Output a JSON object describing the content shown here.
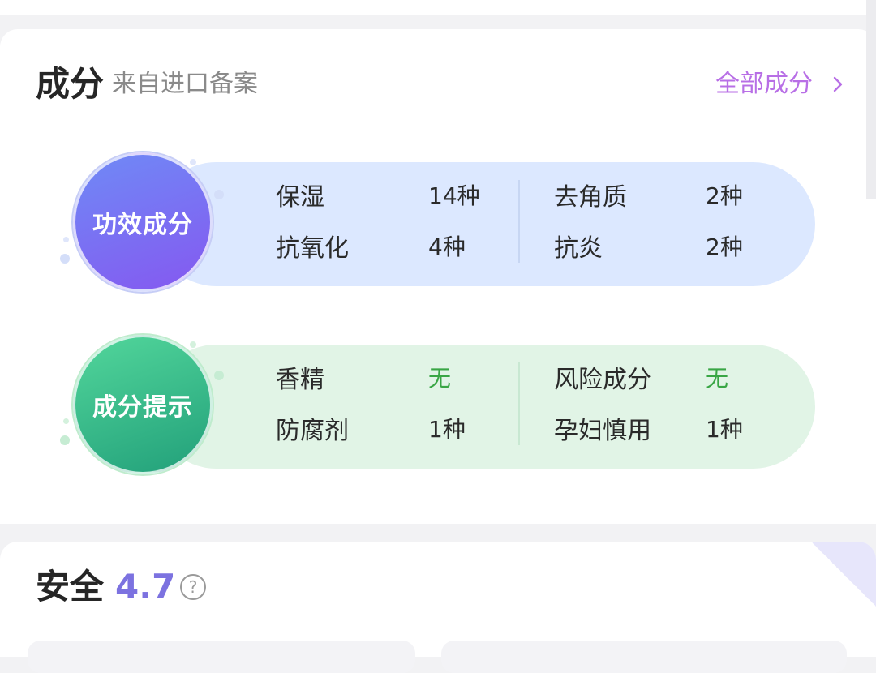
{
  "ingredients": {
    "title": "成分",
    "subtitle": "来自进口备案",
    "all_link": "全部成分"
  },
  "efficacy": {
    "badge": "功效成分",
    "items": [
      {
        "name": "保湿",
        "value": "14种"
      },
      {
        "name": "抗氧化",
        "value": "4种"
      },
      {
        "name": "去角质",
        "value": "2种"
      },
      {
        "name": "抗炎",
        "value": "2种"
      }
    ]
  },
  "tips": {
    "badge": "成分提示",
    "items": [
      {
        "name": "香精",
        "value": "无"
      },
      {
        "name": "防腐剂",
        "value": "1种"
      },
      {
        "name": "风险成分",
        "value": "无"
      },
      {
        "name": "孕妇慎用",
        "value": "1种"
      }
    ]
  },
  "safety": {
    "title": "安全",
    "score": "4.7",
    "help_icon": "?"
  },
  "colors": {
    "accent_purple": "#b86fe6",
    "score_purple": "#7c72e0",
    "none_green": "#39a645"
  }
}
